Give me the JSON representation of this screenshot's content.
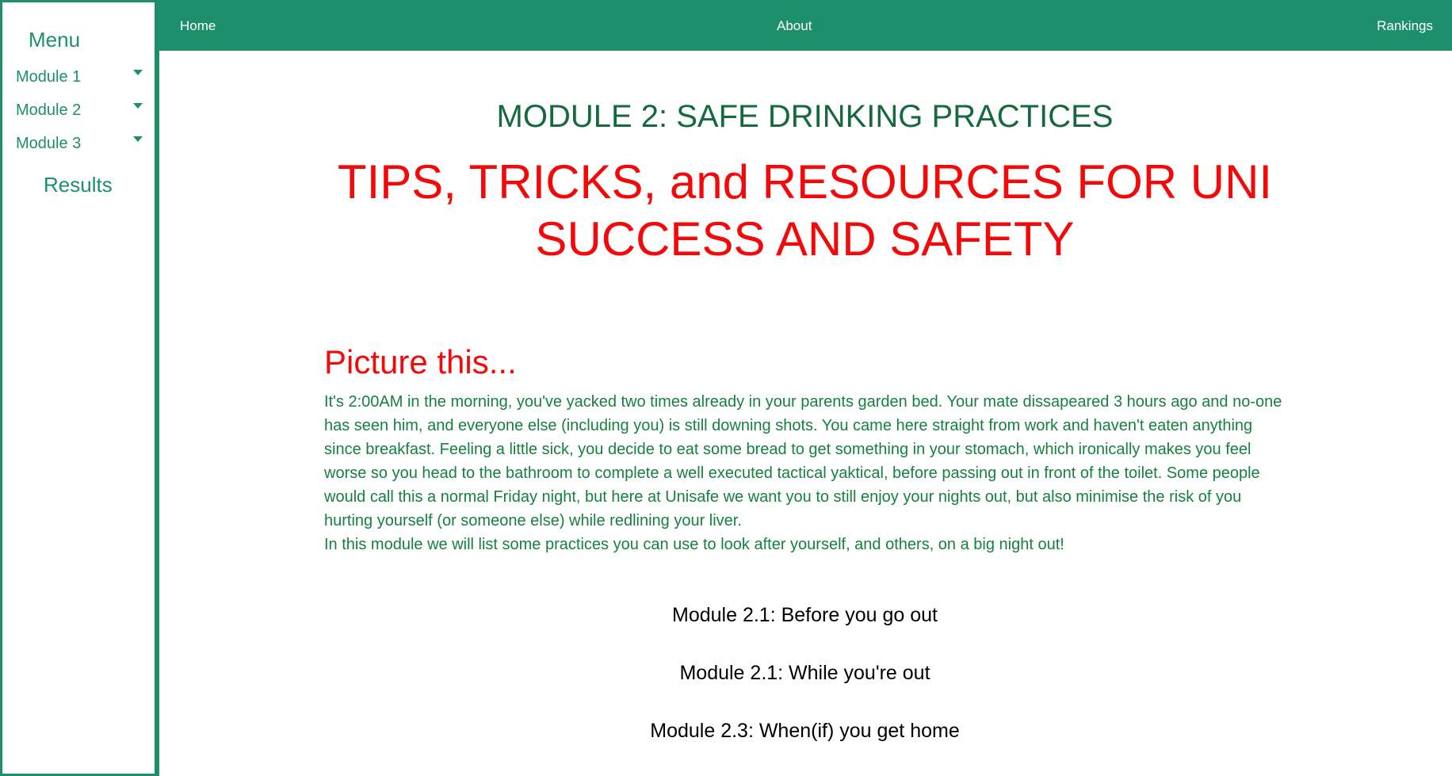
{
  "sidebar": {
    "menu_title": "Menu",
    "modules": [
      {
        "label": "Module 1"
      },
      {
        "label": "Module 2"
      },
      {
        "label": "Module 3"
      }
    ],
    "results_label": "Results"
  },
  "nav": {
    "home": "Home",
    "about": "About",
    "rankings": "Rankings"
  },
  "main": {
    "module_title": "MODULE 2: SAFE DRINKING PRACTICES",
    "tips_title": "TIPS, TRICKS, and RESOURCES FOR UNI SUCCESS AND SAFETY",
    "picture_title": "Picture this...",
    "story_paragraph": "It's 2:00AM in the morning, you've yacked two times already in your parents garden bed. Your mate dissapeared 3 hours ago and no-one has seen him, and everyone else (including you) is still downing shots. You came here straight from work and haven't eaten anything since breakfast. Feeling a little sick, you decide to eat some bread to get something in your stomach, which ironically makes you feel worse so you head to the bathroom to complete a well executed tactical yaktical, before passing out in front of the toilet. Some people would call this a normal Friday night, but here at Unisafe we want you to still enjoy your nights out, but also minimise the risk of you hurting yourself (or someone else) while redlining your liver.",
    "intro_line": "In this module we will list some practices you can use to look after yourself, and others, on a big night out!",
    "submodules": [
      {
        "label": "Module 2.1: Before you go out"
      },
      {
        "label": "Module 2.1: While you're out"
      },
      {
        "label": "Module 2.3: When(if) you get home"
      }
    ]
  },
  "colors": {
    "brand_green": "#1d8f6a",
    "title_red": "#f20a0a",
    "text_green": "#16803f"
  }
}
